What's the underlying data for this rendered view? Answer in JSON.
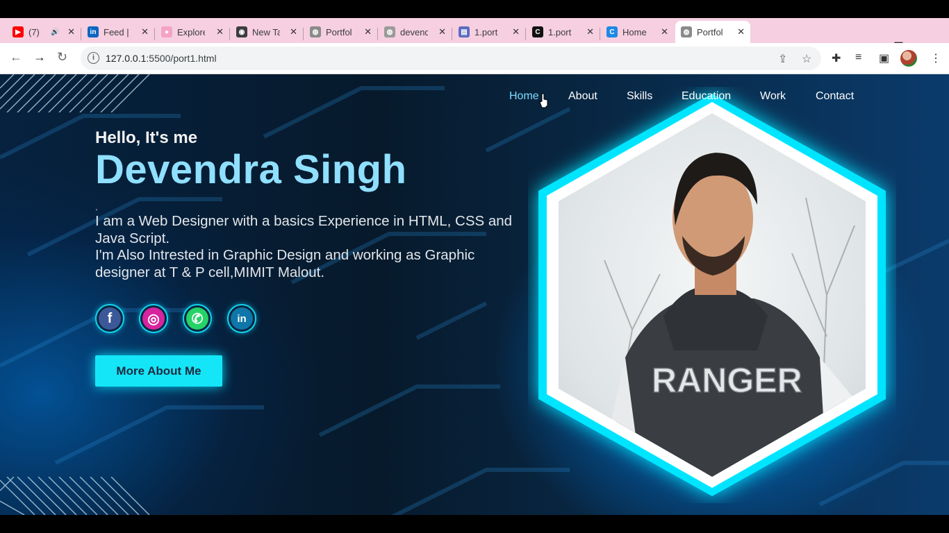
{
  "browser": {
    "tabs": [
      {
        "title": "(7)",
        "favicon": "youtube-icon",
        "color": "#ff0000",
        "glyph": "▶",
        "audio": true
      },
      {
        "title": "Feed |",
        "favicon": "linkedin-icon",
        "color": "#0a66c2",
        "glyph": "in"
      },
      {
        "title": "Explore",
        "favicon": "github-icon",
        "color": "#f5a3c4",
        "glyph": "●"
      },
      {
        "title": "New Ta",
        "favicon": "chrome-icon",
        "color": "#3c3c3c",
        "glyph": "◉"
      },
      {
        "title": "Portfol",
        "favicon": "globe-icon",
        "color": "#8a8a8a",
        "glyph": "◍"
      },
      {
        "title": "devend",
        "favicon": "globe-icon",
        "color": "#9a9a9a",
        "glyph": "◍"
      },
      {
        "title": "1.port",
        "favicon": "form-icon",
        "color": "#5c6bc0",
        "glyph": "▤"
      },
      {
        "title": "1.port",
        "favicon": "circle-c-icon",
        "color": "#111111",
        "glyph": "C"
      },
      {
        "title": "Home",
        "favicon": "c-logo-icon",
        "color": "#1e88e5",
        "glyph": "C"
      },
      {
        "title": "Portfol",
        "favicon": "globe-icon",
        "color": "#8a8a8a",
        "glyph": "◍",
        "active": true
      }
    ],
    "close_glyph": "✕",
    "new_tab": "+",
    "address": {
      "info": "i",
      "host": "127.0.0.1",
      "path": ":5500/port1.html"
    }
  },
  "nav": {
    "items": [
      "Home",
      "About",
      "Skills",
      "Education",
      "Work",
      "Contact"
    ],
    "active": "Home"
  },
  "hero": {
    "greeting": "Hello, It's me",
    "name": "Devendra Singh",
    "dot": ".",
    "description_lines": [
      "I am a Web Designer with a basics Experience in HTML, CSS and",
      "Java Script.",
      "I'm Also Intrested in Graphic Design and working as Graphic",
      "designer at T & P cell,MIMIT Malout."
    ],
    "social": [
      {
        "name": "facebook-icon",
        "glyph": "f",
        "bg": "#3b5998"
      },
      {
        "name": "instagram-icon",
        "glyph": "◎",
        "bg": "#d6249f"
      },
      {
        "name": "whatsapp-icon",
        "glyph": "✆",
        "bg": "#25d366"
      },
      {
        "name": "linkedin-icon",
        "glyph": "in",
        "bg": "#0e76a8"
      }
    ],
    "button_label": "More About Me",
    "photo_text": "RANGER"
  },
  "colors": {
    "accent_cyan": "#14e6f7",
    "name_color": "#8fdfff",
    "tab_strip": "#f6cfe0"
  }
}
